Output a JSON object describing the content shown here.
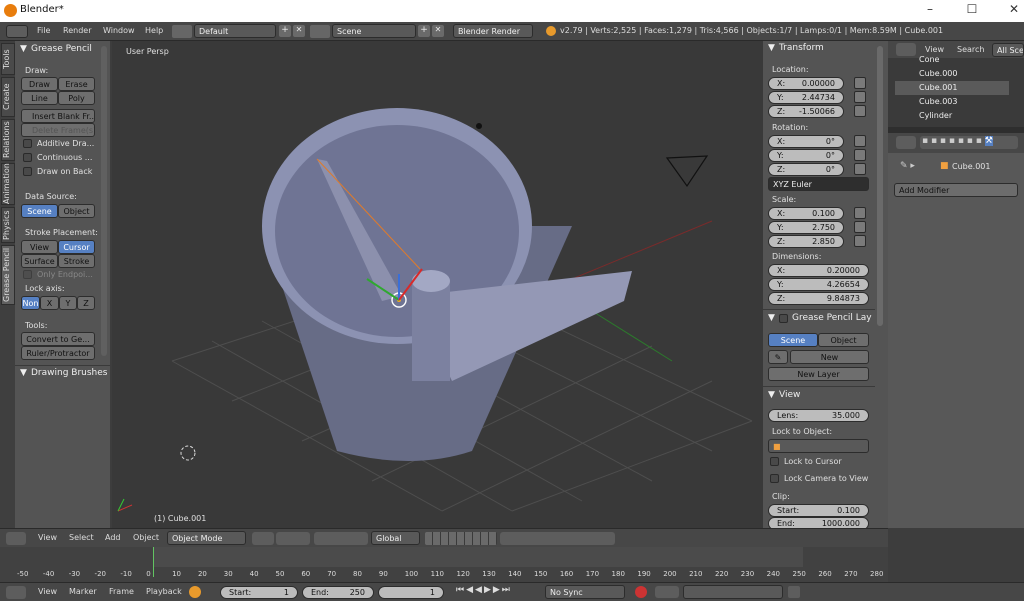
{
  "window": {
    "title": "Blender*",
    "minimize": "–",
    "maximize": "☐",
    "close": "✕"
  },
  "menu": {
    "items": [
      "File",
      "Render",
      "Window",
      "Help"
    ],
    "layout": "Default",
    "scene": "Scene",
    "engine": "Blender Render",
    "stats": "v2.79 | Verts:2,525 | Faces:1,279 | Tris:4,566 | Objects:1/7 | Lamps:0/1 | Mem:8.59M | Cube.001"
  },
  "left_tabs": [
    "Tools",
    "Create",
    "Relations",
    "Animation",
    "Physics",
    "Grease Pencil"
  ],
  "grease": {
    "title": "Grease Pencil",
    "draw_label": "Draw:",
    "draw": "Draw",
    "erase": "Erase",
    "line": "Line",
    "poly": "Poly",
    "insert": "Insert Blank Fr...",
    "delete": "Delete Frame(s)",
    "additive": "Additive Dra...",
    "continuous": "Continuous ...",
    "draw_on_back": "Draw on Back",
    "data_source": "Data Source:",
    "scene": "Scene",
    "object": "Object",
    "stroke_placement": "Stroke Placement:",
    "view": "View",
    "cursor": "Cursor",
    "surface": "Surface",
    "stroke": "Stroke",
    "only_endpoints": "Only Endpoi...",
    "lock_axis": "Lock axis:",
    "axes": [
      "Non",
      "X",
      "Y",
      "Z"
    ],
    "tools": "Tools:",
    "convert": "Convert to Ge...",
    "ruler": "Ruler/Protractor",
    "drawing_brushes": "Drawing Brushes"
  },
  "viewport": {
    "persp": "User Persp",
    "object": "(1) Cube.001"
  },
  "transform": {
    "title": "Transform",
    "location": "Location:",
    "loc": [
      {
        "axis": "X:",
        "value": "0.00000"
      },
      {
        "axis": "Y:",
        "value": "2.44734"
      },
      {
        "axis": "Z:",
        "value": "-1.50066"
      }
    ],
    "rotation": "Rotation:",
    "rot": [
      {
        "axis": "X:",
        "value": "0°"
      },
      {
        "axis": "Y:",
        "value": "0°"
      },
      {
        "axis": "Z:",
        "value": "0°"
      }
    ],
    "euler": "XYZ Euler",
    "scale_label": "Scale:",
    "scale": [
      {
        "axis": "X:",
        "value": "0.100"
      },
      {
        "axis": "Y:",
        "value": "2.750"
      },
      {
        "axis": "Z:",
        "value": "2.850"
      }
    ],
    "dimensions": "Dimensions:",
    "dim": [
      {
        "axis": "X:",
        "value": "0.20000"
      },
      {
        "axis": "Y:",
        "value": "4.26654"
      },
      {
        "axis": "Z:",
        "value": "9.84873"
      }
    ]
  },
  "gp_layers": {
    "title": "Grease Pencil Layers",
    "scene": "Scene",
    "object": "Object",
    "new": "New",
    "new_layer": "New Layer"
  },
  "view_panel": {
    "title": "View",
    "lens_label": "Lens:",
    "lens": "35.000",
    "lock_object": "Lock to Object:",
    "lock_cursor": "Lock to Cursor",
    "lock_camera": "Lock Camera to View",
    "clip": "Clip:",
    "start_label": "Start:",
    "start": "0.100",
    "end_label": "End:",
    "end": "1000.000"
  },
  "outliner": {
    "view": "View",
    "search": "Search",
    "all_scenes": "All Scen",
    "items": [
      "Cone",
      "Cube.000",
      "Cube.001",
      "Cube.003",
      "Cylinder"
    ]
  },
  "properties": {
    "object": "Cube.001",
    "add_modifier": "Add Modifier"
  },
  "header3d": {
    "view": "View",
    "select": "Select",
    "add": "Add",
    "object": "Object",
    "mode": "Object Mode",
    "orientation": "Global"
  },
  "timeline": {
    "ticks": [
      "-50",
      "-40",
      "-30",
      "-20",
      "-10",
      "0",
      "10",
      "20",
      "30",
      "40",
      "50",
      "60",
      "70",
      "80",
      "90",
      "100",
      "110",
      "120",
      "130",
      "140",
      "150",
      "160",
      "170",
      "180",
      "190",
      "200",
      "210",
      "220",
      "230",
      "240",
      "250",
      "260",
      "270",
      "280"
    ],
    "current": 0
  },
  "footer": {
    "view": "View",
    "marker": "Marker",
    "frame": "Frame",
    "playback": "Playback",
    "start_label": "Start:",
    "start": "1",
    "end_label": "End:",
    "end": "250",
    "current": "1",
    "sync": "No Sync"
  }
}
